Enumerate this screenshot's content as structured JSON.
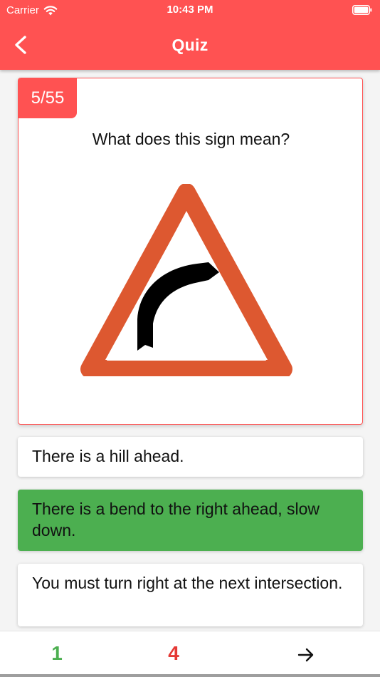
{
  "status_bar": {
    "carrier": "Carrier",
    "time": "10:43 PM"
  },
  "header": {
    "title": "Quiz",
    "back_icon": "chevron-left-icon"
  },
  "question": {
    "counter": "5/55",
    "text": "What does this sign mean?",
    "image": "bend-right-warning-sign"
  },
  "options": [
    {
      "label": "There is a hill ahead.",
      "state": "default"
    },
    {
      "label": "There is a bend to the right ahead, slow down.",
      "state": "correct"
    },
    {
      "label": "You must turn right at the next intersection.",
      "state": "default"
    }
  ],
  "footer": {
    "correct_count": "1",
    "wrong_count": "4",
    "next_icon": "arrow-right-icon"
  },
  "colors": {
    "primary": "#ff5252",
    "correct": "#4caf50",
    "wrong": "#e53935",
    "sign_border": "#dd5830"
  }
}
